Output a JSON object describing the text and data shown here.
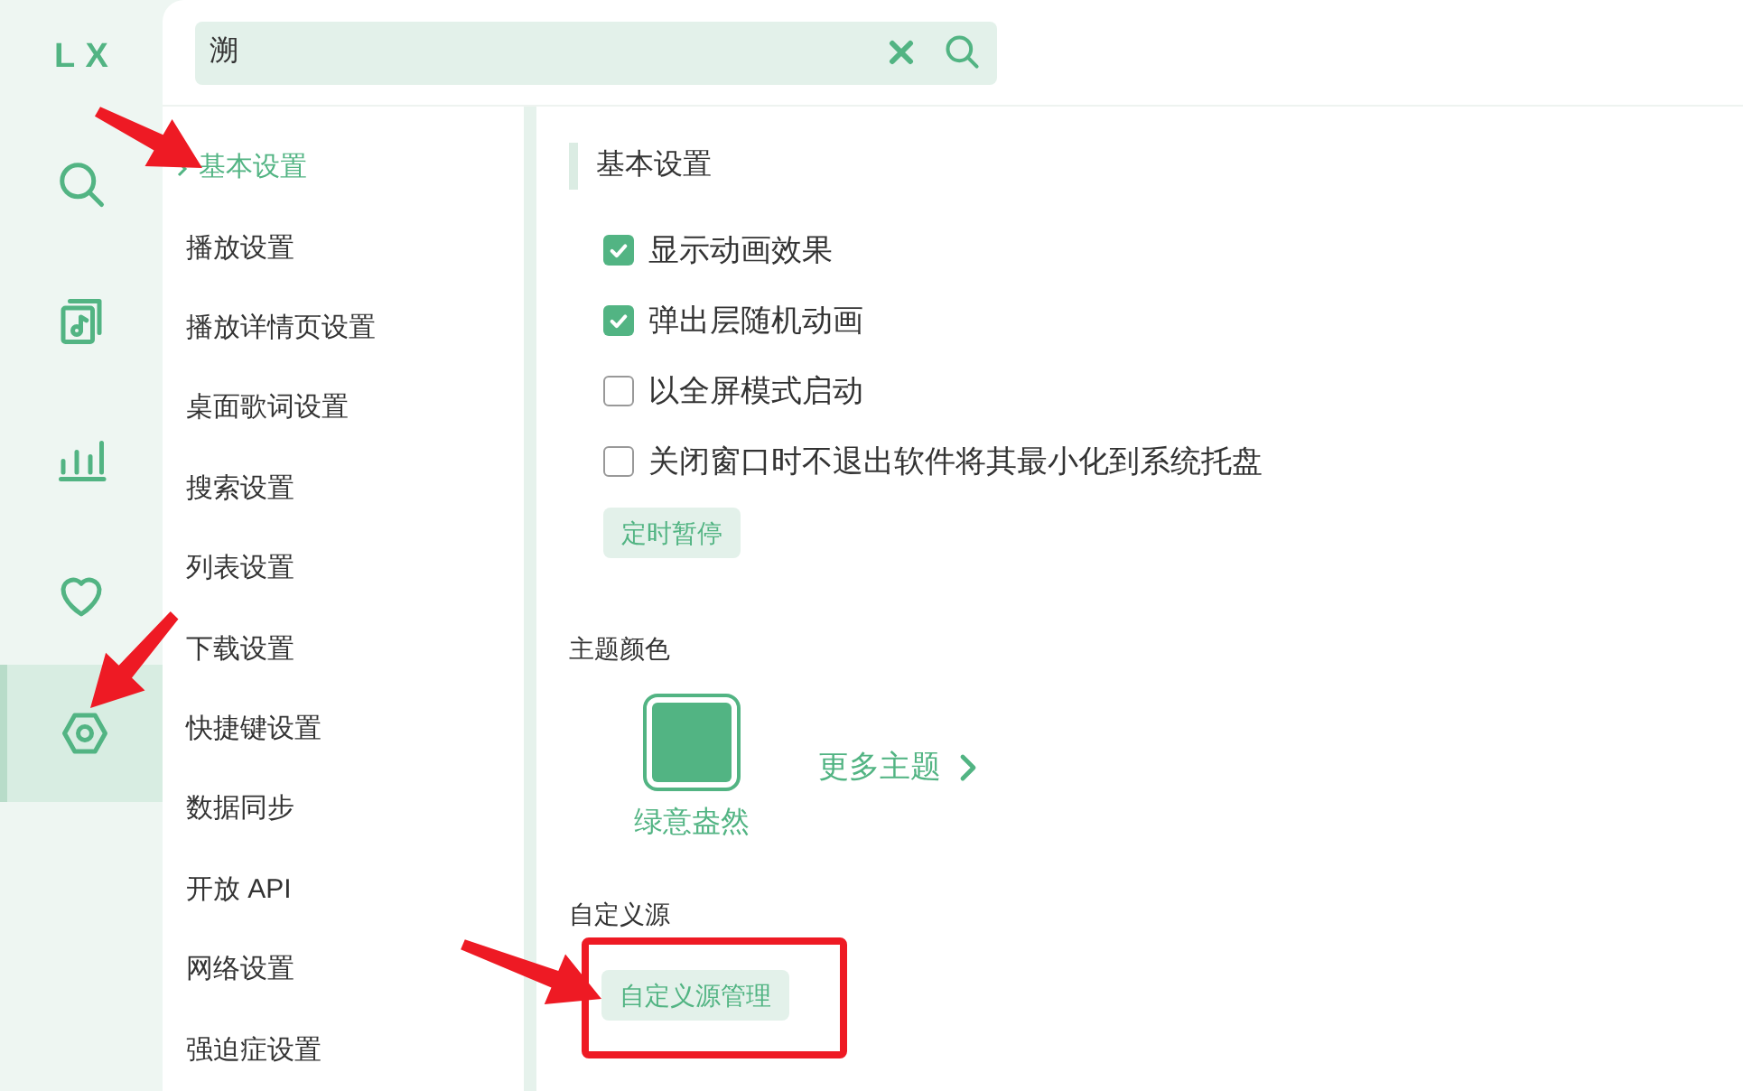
{
  "logo": "LX",
  "nav": [
    {
      "kind": "search",
      "selected": false
    },
    {
      "kind": "music",
      "selected": false
    },
    {
      "kind": "chart",
      "selected": false
    },
    {
      "kind": "heart",
      "selected": false
    },
    {
      "kind": "settings",
      "selected": true
    }
  ],
  "search": {
    "value": "溯"
  },
  "menu": [
    {
      "label": "基本设置",
      "selected": true
    },
    {
      "label": "播放设置",
      "selected": false
    },
    {
      "label": "播放详情页设置",
      "selected": false
    },
    {
      "label": "桌面歌词设置",
      "selected": false
    },
    {
      "label": "搜索设置",
      "selected": false
    },
    {
      "label": "列表设置",
      "selected": false
    },
    {
      "label": "下载设置",
      "selected": false
    },
    {
      "label": "快捷键设置",
      "selected": false
    },
    {
      "label": "数据同步",
      "selected": false
    },
    {
      "label": "开放 API",
      "selected": false
    },
    {
      "label": "网络设置",
      "selected": false
    },
    {
      "label": "强迫症设置",
      "selected": false
    }
  ],
  "section_title": "基本设置",
  "options": [
    {
      "label": "显示动画效果",
      "checked": true
    },
    {
      "label": "弹出层随机动画",
      "checked": true
    },
    {
      "label": "以全屏模式启动",
      "checked": false
    },
    {
      "label": "关闭窗口时不退出软件将其最小化到系统托盘",
      "checked": false
    }
  ],
  "timer_button": "定时暂停",
  "theme": {
    "heading": "主题颜色",
    "themes": [
      {
        "name": "绿意盎然",
        "color": "#52b483",
        "selected": true
      }
    ],
    "more": "更多主题"
  },
  "custom_source": {
    "heading": "自定义源",
    "button": "自定义源管理"
  }
}
